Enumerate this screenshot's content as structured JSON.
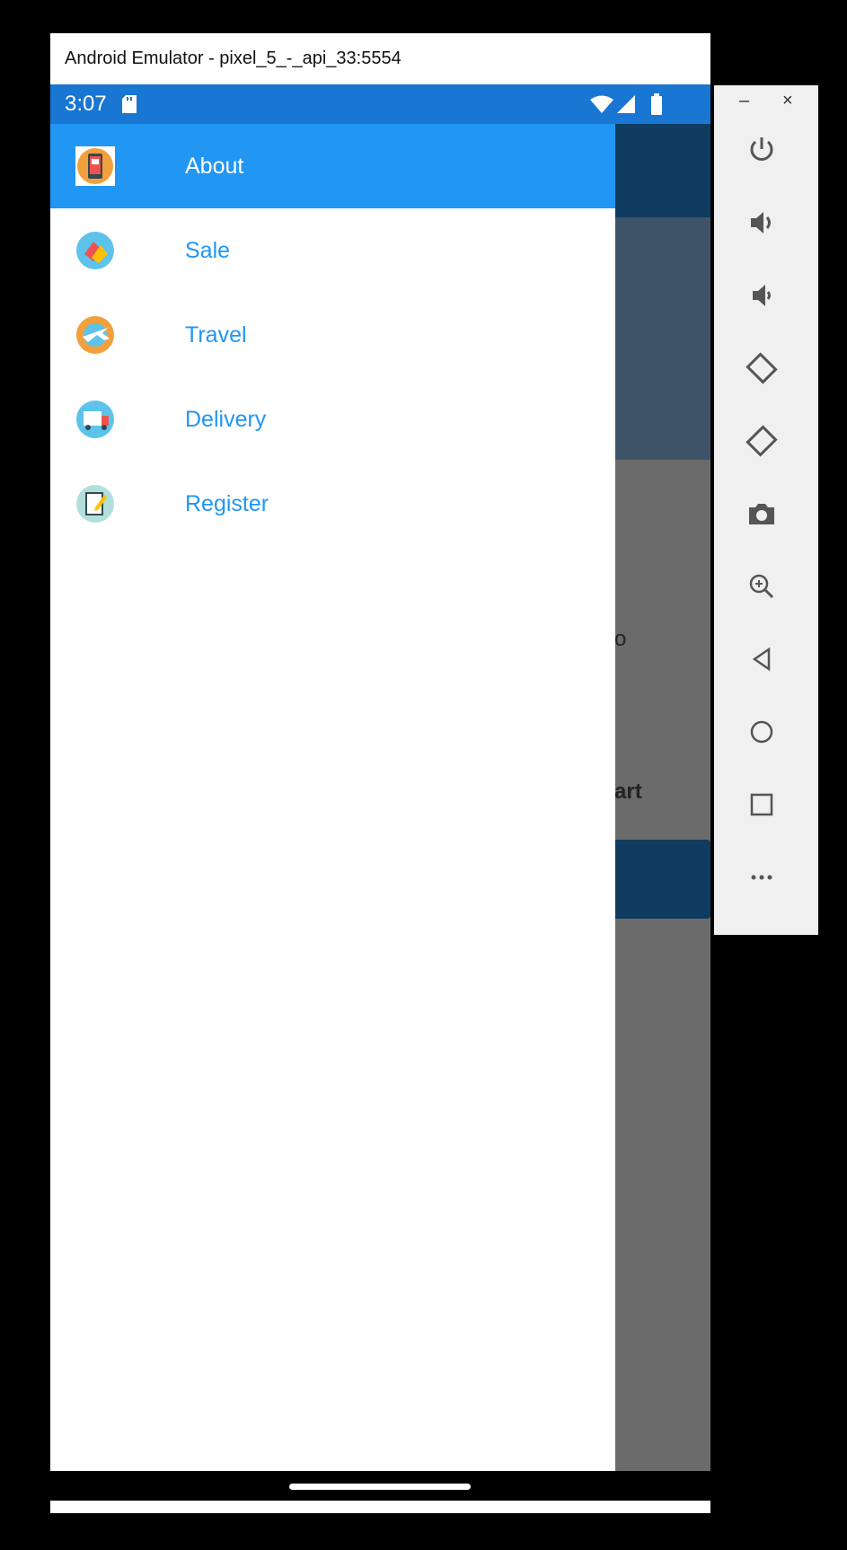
{
  "window": {
    "title": "Android Emulator - pixel_5_-_api_33:5554"
  },
  "status_bar": {
    "time": "3:07"
  },
  "app_background": {
    "text_1": "o",
    "text_2": "art"
  },
  "drawer": {
    "items": [
      {
        "label": "About",
        "icon": "phone-icon",
        "selected": true
      },
      {
        "label": "Sale",
        "icon": "sale-tag-icon",
        "selected": false
      },
      {
        "label": "Travel",
        "icon": "travel-plane-icon",
        "selected": false
      },
      {
        "label": "Delivery",
        "icon": "delivery-truck-icon",
        "selected": false
      },
      {
        "label": "Register",
        "icon": "register-note-icon",
        "selected": false
      }
    ]
  },
  "side_panel": {
    "minimize_label": "–",
    "close_label": "×",
    "buttons": [
      "power-icon",
      "volume-up-icon",
      "volume-down-icon",
      "rotate-left-icon",
      "rotate-right-icon",
      "camera-icon",
      "zoom-icon",
      "back-icon",
      "home-icon",
      "overview-icon",
      "more-icon"
    ]
  },
  "colors": {
    "primary": "#2196F3",
    "status_bar": "#1976D2",
    "toolbar": "#0f3b60"
  }
}
